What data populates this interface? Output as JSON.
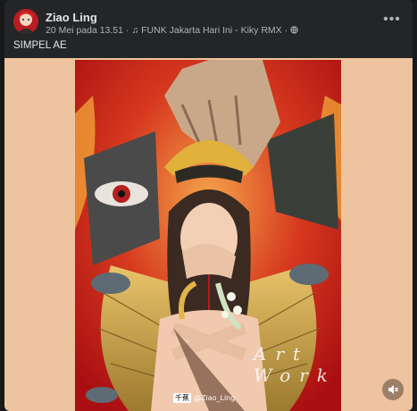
{
  "post": {
    "author": "Ziao Ling",
    "timestamp": "20 Mei pada 13.51",
    "separator": "·",
    "music_text": "FUNK Jakarta Hari Ini - Kiky RMX",
    "more_label": "•••",
    "caption": "SIMPEL AE"
  },
  "media": {
    "watermark_tag": "千蕉",
    "watermark_handle": "@Ziao_Ling",
    "signature": "Art Work"
  },
  "icons": {
    "music": "music-note-icon",
    "audience": "public-globe-icon",
    "sound": "mute-speaker-icon"
  },
  "colors": {
    "background": "#18191a",
    "card": "#242526",
    "media_bg": "#eec39f",
    "art_red": "#c01616"
  }
}
